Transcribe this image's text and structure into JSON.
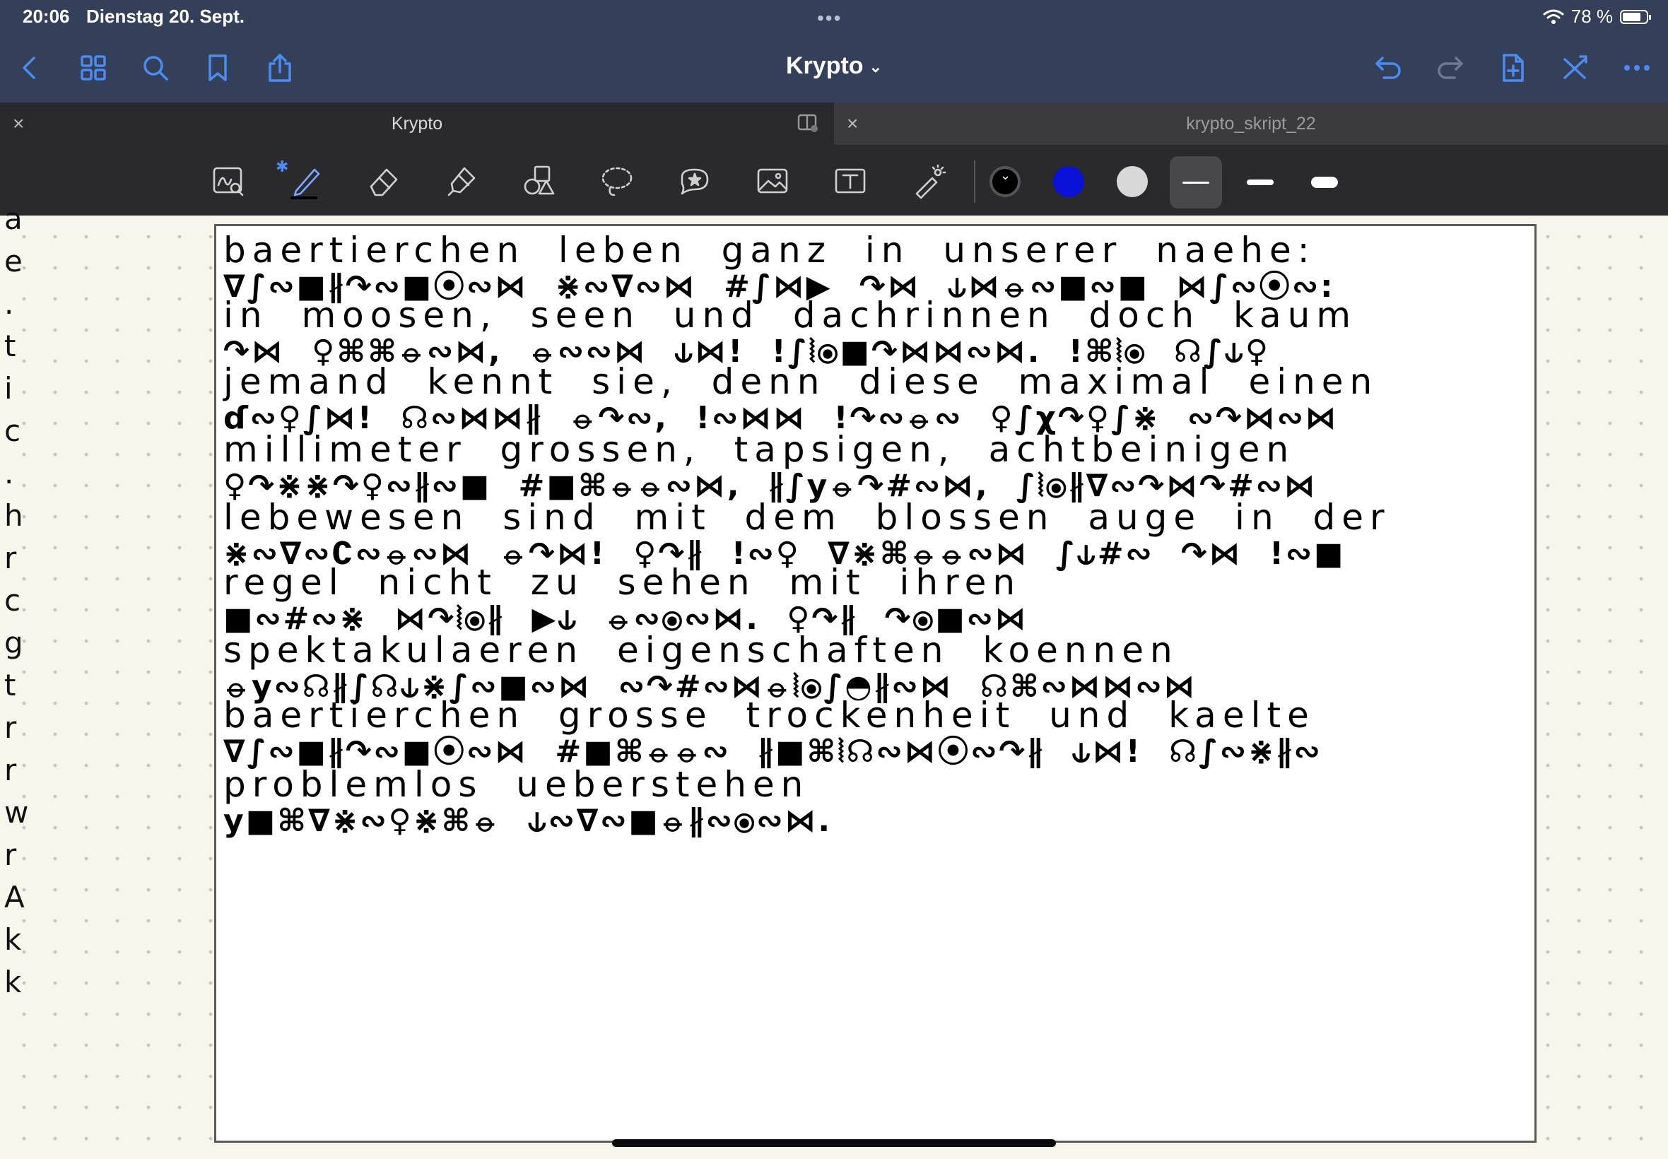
{
  "status_bar": {
    "time": "20:06",
    "date": "Dienstag 20. Sept.",
    "dots": "•••",
    "battery": "78 %",
    "battery_level": 0.78
  },
  "nav": {
    "title": "Krypto",
    "left_icons": [
      "back-icon",
      "grid-icon",
      "search-icon",
      "bookmark-icon",
      "share-icon"
    ],
    "right_icons": [
      "undo-icon",
      "redo-icon",
      "add-page-icon",
      "close-x-icon",
      "more-icon"
    ]
  },
  "tabs": [
    {
      "label": "Krypto",
      "active": true
    },
    {
      "label": "krypto_skript_22",
      "active": false
    }
  ],
  "toolbar": {
    "tools": [
      "zoom-box-tool",
      "pen-tool",
      "eraser-tool",
      "highlighter-tool",
      "shapes-tool",
      "lasso-tool",
      "elements-tool",
      "image-tool",
      "text-tool",
      "laser-pointer-tool"
    ],
    "colors": {
      "black": "#000000",
      "blue": "#0a12d8",
      "gray": "#d8d8d8"
    },
    "stroke_widths": [
      "thin",
      "medium",
      "thick"
    ],
    "selected_stroke": "thin"
  },
  "page": {
    "lines": [
      {
        "plain": "baertierchen leben ganz in unserer naehe:",
        "cipher": "∇∫∾■∦↷∾■⦿∾⋈ ⋇∾∇∾⋈ #∫⋈▶ ↷⋈ ⫝⋈⦵∾■∾■ ⋈∫∾⦿∾:"
      },
      {
        "plain": "in moosen, seen und dachrinnen doch kaum",
        "cipher": "↷⋈ ♀⌘⌘⦵∾⋈, ⦵∾∾⋈ ⫝⋈! !∫⦚⦿■↷⋈⋈∾⋈. !⌘⦚⦿ ☊∫⫝♀"
      },
      {
        "plain": "jemand kennt sie, denn diese maximal einen",
        "cipher": "ɗ∾♀∫⋈! ☊∾⋈⋈∦ ⦵↷∾, !∾⋈⋈ !↷∾⦵∾ ♀∫χ↷♀∫⋇ ∾↷⋈∾⋈"
      },
      {
        "plain": "millimeter grossen, tapsigen, achtbeinigen",
        "cipher": "♀↷⋇⋇↷♀∾∦∾■ #■⌘⦵⦵∾⋈, ∦∫y⦵↷#∾⋈, ∫⦚⦿∦∇∾↷⋈↷#∾⋈"
      },
      {
        "plain": "lebewesen sind mit dem blossen auge in der",
        "cipher": "⋇∾∇∾∁∾⦵∾⋈ ⦵↷⋈! ♀↷∦ !∾♀ ∇⋇⌘⦵⦵∾⋈ ∫⫝#∾ ↷⋈ !∾■"
      },
      {
        "plain": "regel nicht zu sehen mit ihren",
        "cipher": "■∾#∾⋇ ⋈↷⦚⦿∦ ▶⫝ ⦵∾⦿∾⋈. ♀↷∦ ↷⦿■∾⋈"
      },
      {
        "plain": "spektakulaeren eigenschaften koennen",
        "cipher": "⦵y∾☊∦∫☊⫝⋇∫∾■∾⋈ ∾↷#∾⋈⦵⦚⦿∫◓∦∾⋈ ☊⌘∾⋈⋈∾⋈"
      },
      {
        "plain": "baertierchen grosse trockenheit und kaelte",
        "cipher": "∇∫∾■∦↷∾■⦿∾⋈ #■⌘⦵⦵∾ ∦■⌘⦚☊∾⋈⦿∾↷∦ ⫝⋈! ☊∫∾⋇∦∾"
      },
      {
        "plain": "problemlos ueberstehen",
        "cipher": "y■⌘∇⋇∾♀⋇⌘⦵ ⫝∾∇∾■⦵∦∾⦿∾⋈."
      }
    ]
  },
  "left_margin_chars": [
    "a",
    "e",
    ".",
    "t",
    "i",
    "c",
    ".",
    "h",
    "r",
    "c",
    "g",
    "t",
    "r",
    "r",
    "w",
    "r",
    "A",
    "k",
    "k"
  ]
}
